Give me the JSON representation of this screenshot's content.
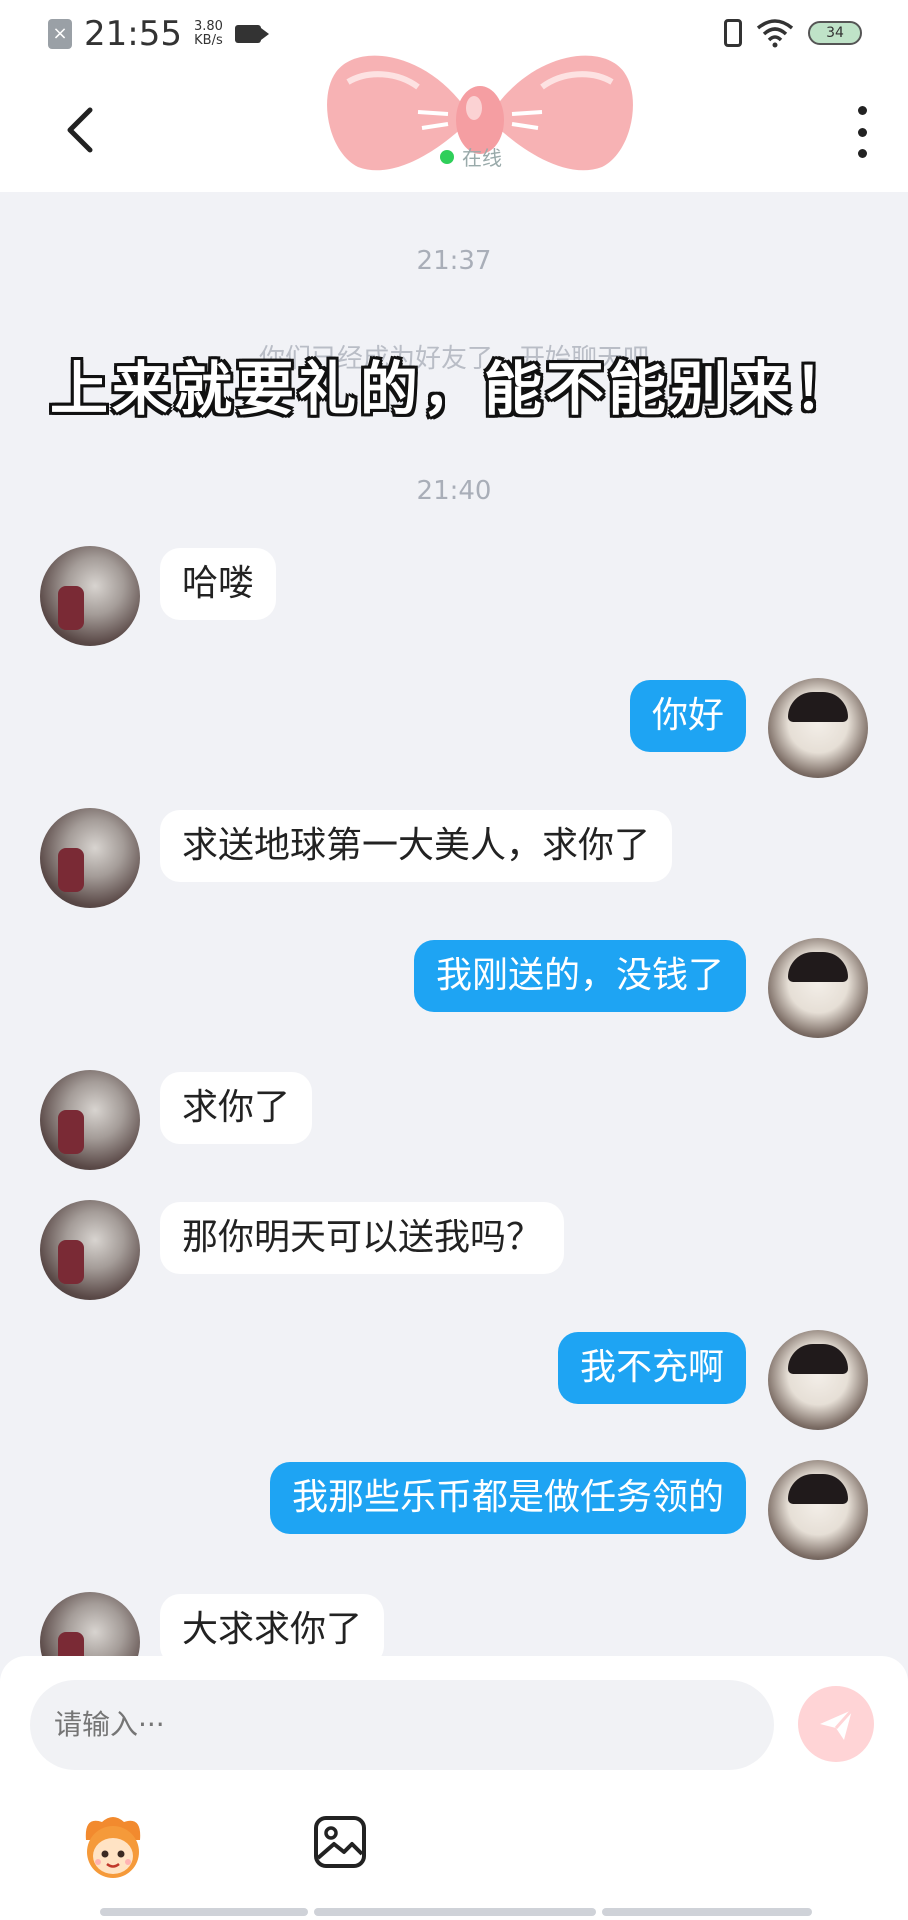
{
  "status_bar": {
    "time": "21:55",
    "net_speed_value": "3.80",
    "net_speed_unit": "KB/s",
    "battery": "34"
  },
  "header": {
    "online_status": "在线"
  },
  "chat": {
    "timestamps": [
      "21:37",
      "21:40"
    ],
    "system_message": "你们已经成为好友了，开始聊天吧",
    "overlay_caption": "上来就要礼的，能不能别来！",
    "messages": [
      {
        "side": "left",
        "text": "哈喽"
      },
      {
        "side": "right",
        "text": "你好"
      },
      {
        "side": "left",
        "text": "求送地球第一大美人，求你了"
      },
      {
        "side": "right",
        "text": "我刚送的，没钱了"
      },
      {
        "side": "left",
        "text": "求你了"
      },
      {
        "side": "left",
        "text": "那你明天可以送我吗？"
      },
      {
        "side": "right",
        "text": "我不充啊"
      },
      {
        "side": "right",
        "text": "我那些乐币都是做任务领的"
      },
      {
        "side": "left",
        "text": "大求求你了"
      }
    ]
  },
  "input": {
    "placeholder": "请输入···"
  },
  "colors": {
    "sent_bubble": "#1ea4f3",
    "received_bubble": "#ffffff",
    "online_dot": "#2fcf5a",
    "send_button": "#ffd4d6"
  },
  "icons": [
    "back-arrow-icon",
    "more-dots-icon",
    "bow-logo",
    "send-icon",
    "mascot-icon",
    "image-icon"
  ]
}
